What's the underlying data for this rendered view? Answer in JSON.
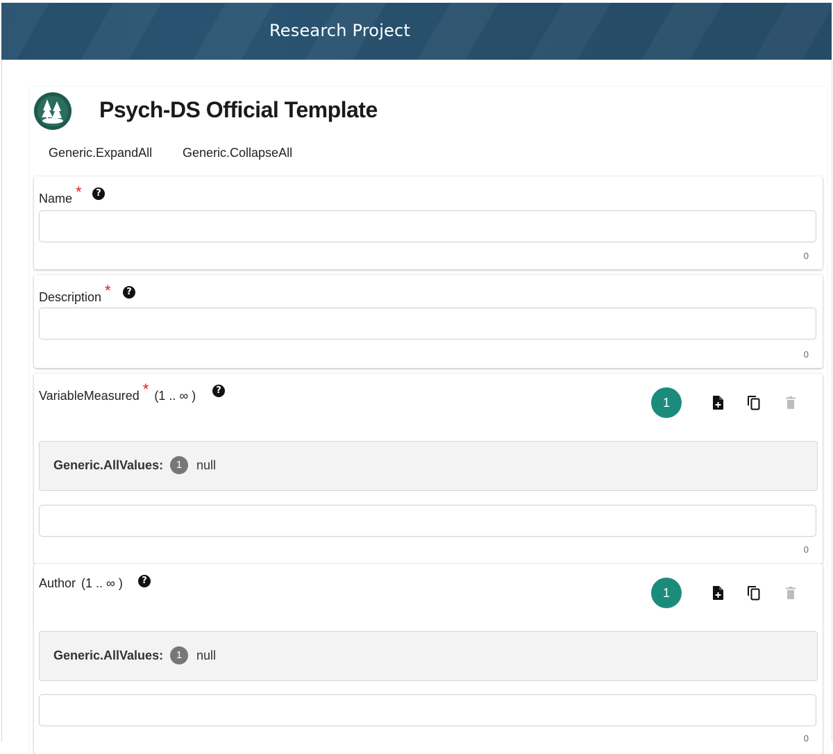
{
  "header": {
    "title": "Research Project"
  },
  "template": {
    "title": "Psych-DS Official Template",
    "expand_all": "Generic.ExpandAll",
    "collapse_all": "Generic.CollapseAll"
  },
  "fields": {
    "name": {
      "label": "Name",
      "required": "*",
      "help": "?",
      "value": "",
      "counter": "0"
    },
    "description": {
      "label": "Description",
      "required": "*",
      "help": "?",
      "value": "",
      "counter": "0"
    },
    "variable_measured": {
      "label": "VariableMeasured",
      "required": "*",
      "cardinality": "(1 .. ∞ )",
      "help": "?",
      "count": "1",
      "values_label": "Generic.AllValues:",
      "values_count": "1",
      "values_text": "null",
      "value": "",
      "counter": "0"
    },
    "author": {
      "label": "Author",
      "cardinality": "(1 .. ∞ )",
      "help": "?",
      "count": "1",
      "values_label": "Generic.AllValues:",
      "values_count": "1",
      "values_text": "null",
      "value": "",
      "counter": "0"
    }
  },
  "icons": [
    "help-icon",
    "add-file-icon",
    "copy-icon",
    "delete-icon",
    "tree-logo-icon"
  ],
  "colors": {
    "header": "#27506d",
    "badge": "#1b8c7b",
    "required": "#e21b1b"
  }
}
